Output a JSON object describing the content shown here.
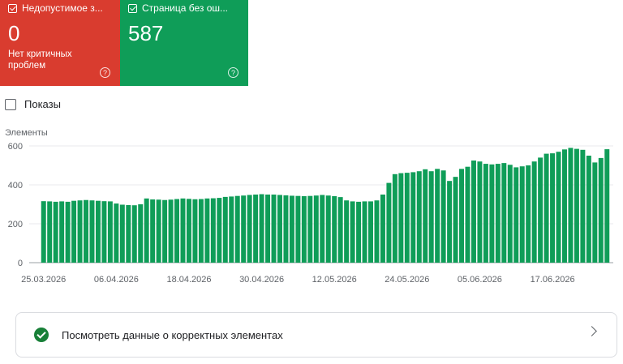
{
  "cards": {
    "invalid": {
      "label": "Недопустимое з...",
      "value": "0",
      "subtitle": "Нет критичных проблем",
      "help": "?",
      "color": "#d93c2f",
      "checked": true
    },
    "valid": {
      "label": "Страница без ош...",
      "value": "587",
      "help": "?",
      "color": "#0f9d58",
      "checked": true
    }
  },
  "impressions": {
    "label": "Показы",
    "checked": false
  },
  "chart_data": {
    "type": "bar",
    "ylabel": "Элементы",
    "ylim": [
      0,
      600
    ],
    "yticks": [
      0,
      200,
      400,
      600
    ],
    "bar_color": "#0f9d58",
    "grid": true,
    "x_tick_labels": [
      "25.03.2026",
      "06.04.2026",
      "18.04.2026",
      "30.04.2026",
      "12.05.2026",
      "24.05.2026",
      "05.06.2026",
      "17.06.2026"
    ],
    "x_tick_indices": [
      0,
      12,
      24,
      36,
      48,
      60,
      72,
      84
    ],
    "values": [
      316,
      315,
      313,
      315,
      313,
      318,
      320,
      322,
      320,
      318,
      316,
      315,
      304,
      298,
      296,
      295,
      300,
      330,
      325,
      324,
      322,
      324,
      327,
      330,
      328,
      326,
      327,
      330,
      331,
      333,
      338,
      340,
      343,
      345,
      348,
      350,
      352,
      350,
      350,
      348,
      346,
      344,
      343,
      342,
      343,
      345,
      348,
      345,
      342,
      337,
      320,
      315,
      313,
      315,
      315,
      320,
      350,
      410,
      455,
      460,
      462,
      465,
      470,
      480,
      470,
      482,
      474,
      420,
      441,
      482,
      493,
      525,
      520,
      508,
      505,
      508,
      512,
      503,
      490,
      495,
      500,
      520,
      540,
      560,
      562,
      570,
      582,
      590,
      585,
      580,
      550,
      515,
      538,
      583
    ]
  },
  "link_card": {
    "label": "Посмотреть данные о корректных элементах"
  }
}
